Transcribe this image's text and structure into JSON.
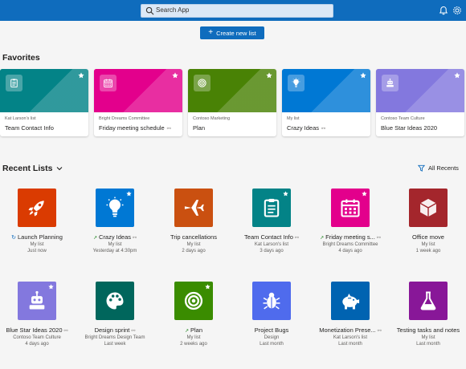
{
  "colors": {
    "brand": "#0f6cbd",
    "teal": "#038387",
    "pink": "#e3008c",
    "green": "#498205",
    "blue": "#0078d4",
    "purple": "#8378de",
    "red_orange": "#ca5010",
    "orange": "#da3b01",
    "dark_red": "#a4262c",
    "dark_teal": "#00665c",
    "mid_green": "#3a8c00",
    "indigo": "#4f6bed",
    "steel_blue": "#0063b1",
    "violet": "#881798"
  },
  "search": {
    "placeholder": "Search App"
  },
  "toolbar": {
    "create_label": "Create new list"
  },
  "favorites": {
    "title": "Favorites",
    "items": [
      {
        "owner": "Kat Larson's list",
        "name": "Team Contact Info",
        "icon": "clipboard-icon",
        "color": "#038387"
      },
      {
        "owner": "Bright Dreams Committee",
        "name": "Friday meeting schedule",
        "icon": "calendar-icon",
        "color": "#e3008c"
      },
      {
        "owner": "Contoso Marketing",
        "name": "Plan",
        "icon": "target-icon",
        "color": "#498205"
      },
      {
        "owner": "My list",
        "name": "Crazy Ideas",
        "icon": "lightbulb-icon",
        "color": "#0078d4"
      },
      {
        "owner": "Contoso Team Culture",
        "name": "Blue Star Ideas 2020",
        "icon": "robot-icon",
        "color": "#8378de"
      }
    ]
  },
  "recent": {
    "title": "Recent Lists",
    "filter_label": "All Recents",
    "items": [
      {
        "name": "Launch Planning",
        "owner": "My list",
        "time": "Just now",
        "icon": "rocket-icon",
        "color": "#da3b01"
      },
      {
        "name": "Crazy Ideas",
        "owner": "My list",
        "time": "Yesterday at 4:30pm",
        "icon": "lightbulb-icon",
        "color": "#0078d4"
      },
      {
        "name": "Trip cancellations",
        "owner": "My list",
        "time": "2 days ago",
        "icon": "airplane-icon",
        "color": "#ca5010"
      },
      {
        "name": "Team Contact Info",
        "owner": "Kat Larson's list",
        "time": "3 days ago",
        "icon": "clipboard-icon",
        "color": "#038387"
      },
      {
        "name": "Friday meeting s...",
        "owner": "Bright Dreams Committee",
        "time": "4 days ago",
        "icon": "calendar-icon",
        "color": "#e3008c"
      },
      {
        "name": "Office move",
        "owner": "My list",
        "time": "1 week ago",
        "icon": "cube-icon",
        "color": "#a4262c"
      },
      {
        "name": "Blue Star Ideas 2020",
        "owner": "Contoso Team Culture",
        "time": "4 days ago",
        "icon": "robot-icon",
        "color": "#8378de"
      },
      {
        "name": "Design sprint",
        "owner": "Bright Dreams Design Team",
        "time": "Last week",
        "icon": "palette-icon",
        "color": "#00665c"
      },
      {
        "name": "Plan",
        "owner": "My list",
        "time": "2 weeks ago",
        "icon": "target-icon",
        "color": "#3a8c00"
      },
      {
        "name": "Project Bugs",
        "owner": "Design",
        "time": "Last month",
        "icon": "bug-icon",
        "color": "#4f6bed"
      },
      {
        "name": "Monetization Prese...",
        "owner": "Kat Larson's list",
        "time": "Last month",
        "icon": "piggy-bank-icon",
        "color": "#0063b1"
      },
      {
        "name": "Testing tasks and notes",
        "owner": "My list",
        "time": "Last month",
        "icon": "flask-icon",
        "color": "#881798"
      }
    ]
  }
}
